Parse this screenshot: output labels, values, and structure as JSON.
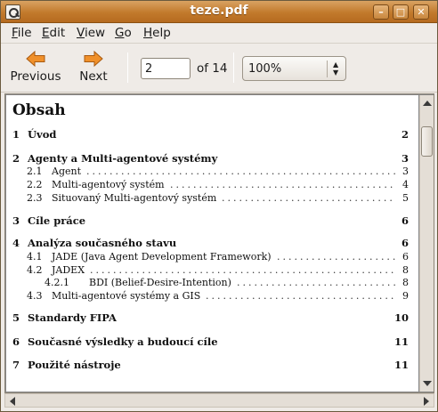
{
  "window": {
    "title": "teze.pdf",
    "controls": {
      "minimize": "–",
      "maximize": "□",
      "close": "✕"
    }
  },
  "menubar": {
    "items": [
      {
        "label": "File",
        "mnemonic": "F",
        "rest": "ile"
      },
      {
        "label": "Edit",
        "mnemonic": "E",
        "rest": "dit"
      },
      {
        "label": "View",
        "mnemonic": "V",
        "rest": "iew"
      },
      {
        "label": "Go",
        "mnemonic": "G",
        "rest": "o"
      },
      {
        "label": "Help",
        "mnemonic": "H",
        "rest": "elp"
      }
    ]
  },
  "toolbar": {
    "previous_label": "Previous",
    "next_label": "Next",
    "page_value": "2",
    "page_total_label": "of 14",
    "zoom_value": "100%",
    "icon_color": "#e8821e"
  },
  "document": {
    "heading": "Obsah",
    "entries": [
      {
        "level": 0,
        "num": "1",
        "title": "Úvod",
        "page": "2"
      },
      {
        "level": 0,
        "num": "2",
        "title": "Agenty a Multi-agentové systémy",
        "page": "3"
      },
      {
        "level": 1,
        "num": "2.1",
        "title": "Agent",
        "page": "3"
      },
      {
        "level": 1,
        "num": "2.2",
        "title": "Multi-agentový systém",
        "page": "4"
      },
      {
        "level": 1,
        "num": "2.3",
        "title": "Situovaný Multi-agentový systém",
        "page": "5"
      },
      {
        "level": 0,
        "num": "3",
        "title": "Cíle práce",
        "page": "6"
      },
      {
        "level": 0,
        "num": "4",
        "title": "Analýza současného stavu",
        "page": "6"
      },
      {
        "level": 1,
        "num": "4.1",
        "title": "JADE (Java Agent Development Framework)",
        "page": "6"
      },
      {
        "level": 1,
        "num": "4.2",
        "title": "JADEX",
        "page": "8"
      },
      {
        "level": 2,
        "num": "4.2.1",
        "title": "BDI (Belief-Desire-Intention)",
        "page": "8"
      },
      {
        "level": 1,
        "num": "4.3",
        "title": "Multi-agentové systémy a GIS",
        "page": "9"
      },
      {
        "level": 0,
        "num": "5",
        "title": "Standardy FIPA",
        "page": "10"
      },
      {
        "level": 0,
        "num": "6",
        "title": "Současné výsledky a budoucí cíle",
        "page": "11"
      },
      {
        "level": 0,
        "num": "7",
        "title": "Použité nástroje",
        "page": "11"
      }
    ]
  }
}
